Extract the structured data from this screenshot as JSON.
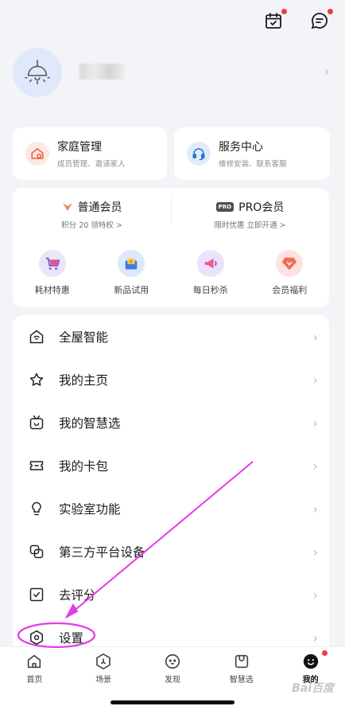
{
  "header": {
    "calendar_icon": "calendar-check-icon",
    "message_icon": "chat-bubble-icon"
  },
  "profile": {
    "avatar_icon": "lamp-icon"
  },
  "quick_cards": [
    {
      "title": "家庭管理",
      "subtitle": "成员管理、邀请家人",
      "icon": "home-settings-icon",
      "color": "#f05a3c"
    },
    {
      "title": "服务中心",
      "subtitle": "维修安装、联系客服",
      "icon": "headset-icon",
      "color": "#2a6fd8"
    }
  ],
  "membership": [
    {
      "title": "普通会员",
      "subtitle": "积分 20 领特权",
      "arrow": ">"
    },
    {
      "badge": "PRO",
      "title": "PRO会员",
      "subtitle": "限时优惠 立即开通",
      "arrow": ">"
    }
  ],
  "benefits": [
    {
      "label": "耗材特惠",
      "icon": "cart-icon"
    },
    {
      "label": "新品试用",
      "icon": "gift-icon"
    },
    {
      "label": "每日秒杀",
      "icon": "megaphone-icon"
    },
    {
      "label": "会员福利",
      "icon": "diamond-icon"
    }
  ],
  "menu": [
    {
      "label": "全屋智能",
      "icon": "smart-home-icon"
    },
    {
      "label": "我的主页",
      "icon": "star-icon"
    },
    {
      "label": "我的智慧选",
      "icon": "tv-smile-icon"
    },
    {
      "label": "我的卡包",
      "icon": "ticket-icon"
    },
    {
      "label": "实验室功能",
      "icon": "bulb-icon"
    },
    {
      "label": "第三方平台设备",
      "icon": "link-icon"
    },
    {
      "label": "去评分",
      "icon": "check-square-icon"
    },
    {
      "label": "设置",
      "icon": "settings-icon"
    }
  ],
  "bottom_nav": [
    {
      "label": "首页",
      "icon": "home-icon"
    },
    {
      "label": "场景",
      "icon": "scene-icon"
    },
    {
      "label": "发现",
      "icon": "discover-icon"
    },
    {
      "label": "智慧选",
      "icon": "bag-icon"
    },
    {
      "label": "我的",
      "icon": "me-icon",
      "active": true
    }
  ],
  "watermark": "Bai百度",
  "colors": {
    "annotation": "#e23ce6",
    "badge": "#f23a3a"
  }
}
